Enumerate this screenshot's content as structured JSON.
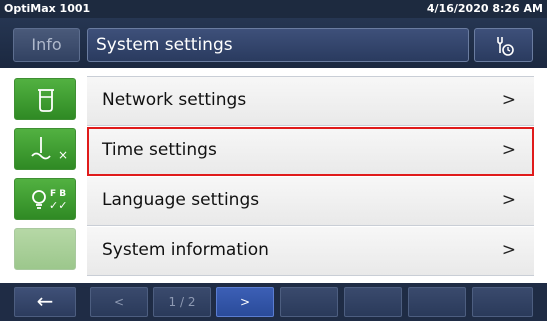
{
  "statusbar": {
    "device_name": "OptiMax 1001",
    "datetime": "4/16/2020 8:26 AM"
  },
  "header": {
    "info_label": "Info",
    "title": "System settings",
    "tools_icon": "wrench-clock-icon"
  },
  "sidebar": {
    "buttons": [
      {
        "icon": "beaker-icon",
        "enabled": true
      },
      {
        "icon": "stirrer-off-icon",
        "badge": "×",
        "enabled": true
      },
      {
        "icon": "lightbulb-fb-check-icon",
        "badge_top": "F B",
        "badge_bottom": "✓✓",
        "enabled": true
      },
      {
        "icon": "",
        "enabled": false
      }
    ]
  },
  "menu": {
    "items": [
      {
        "label": "Network settings",
        "chevron": ">",
        "selected": false
      },
      {
        "label": "Time settings",
        "chevron": ">",
        "selected": true
      },
      {
        "label": "Language settings",
        "chevron": ">",
        "selected": false
      },
      {
        "label": "System information",
        "chevron": ">",
        "selected": false
      }
    ]
  },
  "footer": {
    "back_glyph": "←",
    "prev_glyph": "<",
    "page_indicator": "1 / 2",
    "next_glyph": ">"
  },
  "colors": {
    "accent_green": "#3ea030",
    "selection_red": "#e01b1b",
    "header_navy": "#263652",
    "page_active_blue": "#2f52a8"
  }
}
